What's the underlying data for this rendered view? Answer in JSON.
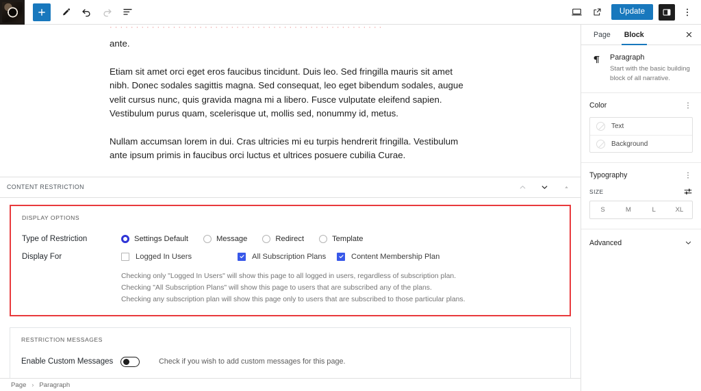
{
  "topbar": {
    "logo_name": "site-logo",
    "add_block_label": "+",
    "tools": [
      {
        "name": "add-block-button",
        "icon": "plus-icon",
        "title": "Add block"
      },
      {
        "name": "tools-button",
        "icon": "pencil-icon",
        "title": "Tools"
      },
      {
        "name": "undo-button",
        "icon": "undo-icon",
        "title": "Undo"
      },
      {
        "name": "redo-button",
        "icon": "redo-icon",
        "title": "Redo"
      },
      {
        "name": "list-view-button",
        "icon": "list-view-icon",
        "title": "List view"
      }
    ],
    "preview_label": "Preview",
    "view_label": "View",
    "update_label": "Update",
    "settings_label": "Settings",
    "options_label": "Options"
  },
  "editor": {
    "clipped_line": "· · · · · · · ·    · · · · · · · · ·    · · · · · ·    · · · · · · · ·    · · · · · · · · · · · ·    · · · · · · · · ·",
    "paragraphs": [
      "ante.",
      "Etiam sit amet orci eget eros faucibus tincidunt. Duis leo. Sed fringilla mauris sit amet nibh. Donec sodales sagittis magna. Sed consequat, leo eget bibendum sodales, augue velit cursus nunc, quis gravida magna mi a libero. Fusce vulputate eleifend sapien. Vestibulum purus quam, scelerisque ut, mollis sed, nonummy id, metus.",
      "Nullam accumsan lorem in dui. Cras ultricies mi eu turpis hendrerit fringilla. Vestibulum ante ipsum primis in faucibus orci luctus et ultrices posuere cubilia Curae."
    ]
  },
  "metabox": {
    "title": "CONTENT RESTRICTION",
    "move_up_label": "Move up",
    "move_down_label": "Move down",
    "collapse_label": "Toggle panel"
  },
  "display_options": {
    "section_label": "DISPLAY OPTIONS",
    "type_of_restriction": {
      "label": "Type of Restriction",
      "options": [
        {
          "label": "Settings Default",
          "checked": true
        },
        {
          "label": "Message",
          "checked": false
        },
        {
          "label": "Redirect",
          "checked": false
        },
        {
          "label": "Template",
          "checked": false
        }
      ]
    },
    "display_for": {
      "label": "Display For",
      "options": [
        {
          "label": "Logged In Users",
          "checked": false
        },
        {
          "label": "All Subscription Plans",
          "checked": true
        },
        {
          "label": "Content Membership Plan",
          "checked": true
        }
      ]
    },
    "help_lines": [
      "Checking only \"Logged In Users\" will show this page to all logged in users, regardless of subscription plan.",
      "Checking \"All Subscription Plans\" will show this page to users that are subscribed any of the plans.",
      "Checking any subscription plan will show this page only to users that are subscribed to those particular plans."
    ]
  },
  "restriction_messages": {
    "section_label": "RESTRICTION MESSAGES",
    "toggle_label": "Enable Custom Messages",
    "toggle_state": "off",
    "toggle_help": "Check if you wish to add custom messages for this page."
  },
  "breadcrumb": {
    "items": [
      "Page",
      "Paragraph"
    ],
    "separator": "›"
  },
  "sidebar": {
    "tabs": [
      {
        "label": "Page",
        "active": false
      },
      {
        "label": "Block",
        "active": true
      }
    ],
    "close_label": "Close settings",
    "block": {
      "icon": "paragraph-icon",
      "glyph": "¶",
      "title": "Paragraph",
      "description": "Start with the basic building block of all narrative."
    },
    "color": {
      "title": "Color",
      "options_label": "Color options",
      "rows": [
        {
          "label": "Text"
        },
        {
          "label": "Background"
        }
      ]
    },
    "typography": {
      "title": "Typography",
      "options_label": "Typography options",
      "size_label": "SIZE",
      "tune_label": "Set custom size",
      "sizes": [
        "S",
        "M",
        "L",
        "XL"
      ]
    },
    "advanced": {
      "title": "Advanced"
    }
  },
  "colors": {
    "accent": "#1878bd",
    "radio_checked": "#2f34d6",
    "checkbox_checked": "#3858e9",
    "highlight_border": "#e8393c"
  }
}
